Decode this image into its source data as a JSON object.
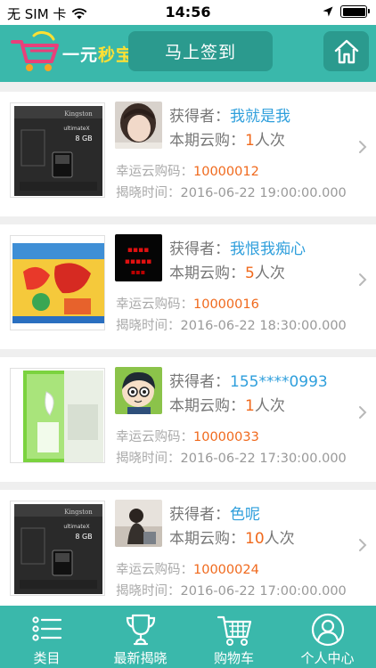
{
  "status_bar": {
    "carrier": "无 SIM 卡",
    "time": "14:56"
  },
  "header": {
    "logo_text_main": "一元",
    "logo_text_highlight": "秒宝",
    "signin_label": "马上签到",
    "home_icon": "home-icon"
  },
  "labels": {
    "winner": "获得者：",
    "participation": "本期云购：",
    "lucky_code": "幸运云购码：",
    "reveal_time": "揭晓时间："
  },
  "items": [
    {
      "product": "Kingston 8GB microSD card",
      "winner": "我就是我",
      "count": "1",
      "unit": "人次",
      "lucky_code": "10000012",
      "reveal_time": "2016-06-22 19:00:00.000"
    },
    {
      "product": "toy package",
      "winner": "我恨我痴心",
      "count": "5",
      "unit": "人次",
      "lucky_code": "10000016",
      "reveal_time": "2016-06-22 18:30:00.000"
    },
    {
      "product": "white earphone",
      "winner": "155****0993",
      "count": "1",
      "unit": "人次",
      "lucky_code": "10000033",
      "reveal_time": "2016-06-22 17:30:00.000"
    },
    {
      "product": "Kingston 8GB microSD card",
      "winner": "色呢",
      "count": "10",
      "unit": "人次",
      "lucky_code": "10000024",
      "reveal_time": "2016-06-22 17:00:00.000"
    }
  ],
  "tabbar": [
    {
      "label": "类目",
      "icon": "list-icon"
    },
    {
      "label": "最新揭晓",
      "icon": "trophy-icon"
    },
    {
      "label": "购物车",
      "icon": "cart-icon"
    },
    {
      "label": "个人中心",
      "icon": "user-icon"
    }
  ],
  "colors": {
    "brand": "#3ab8ab",
    "brand_dark": "#2b9a8e",
    "winner_blue": "#2f9fdc",
    "accent_orange": "#f0691c"
  }
}
